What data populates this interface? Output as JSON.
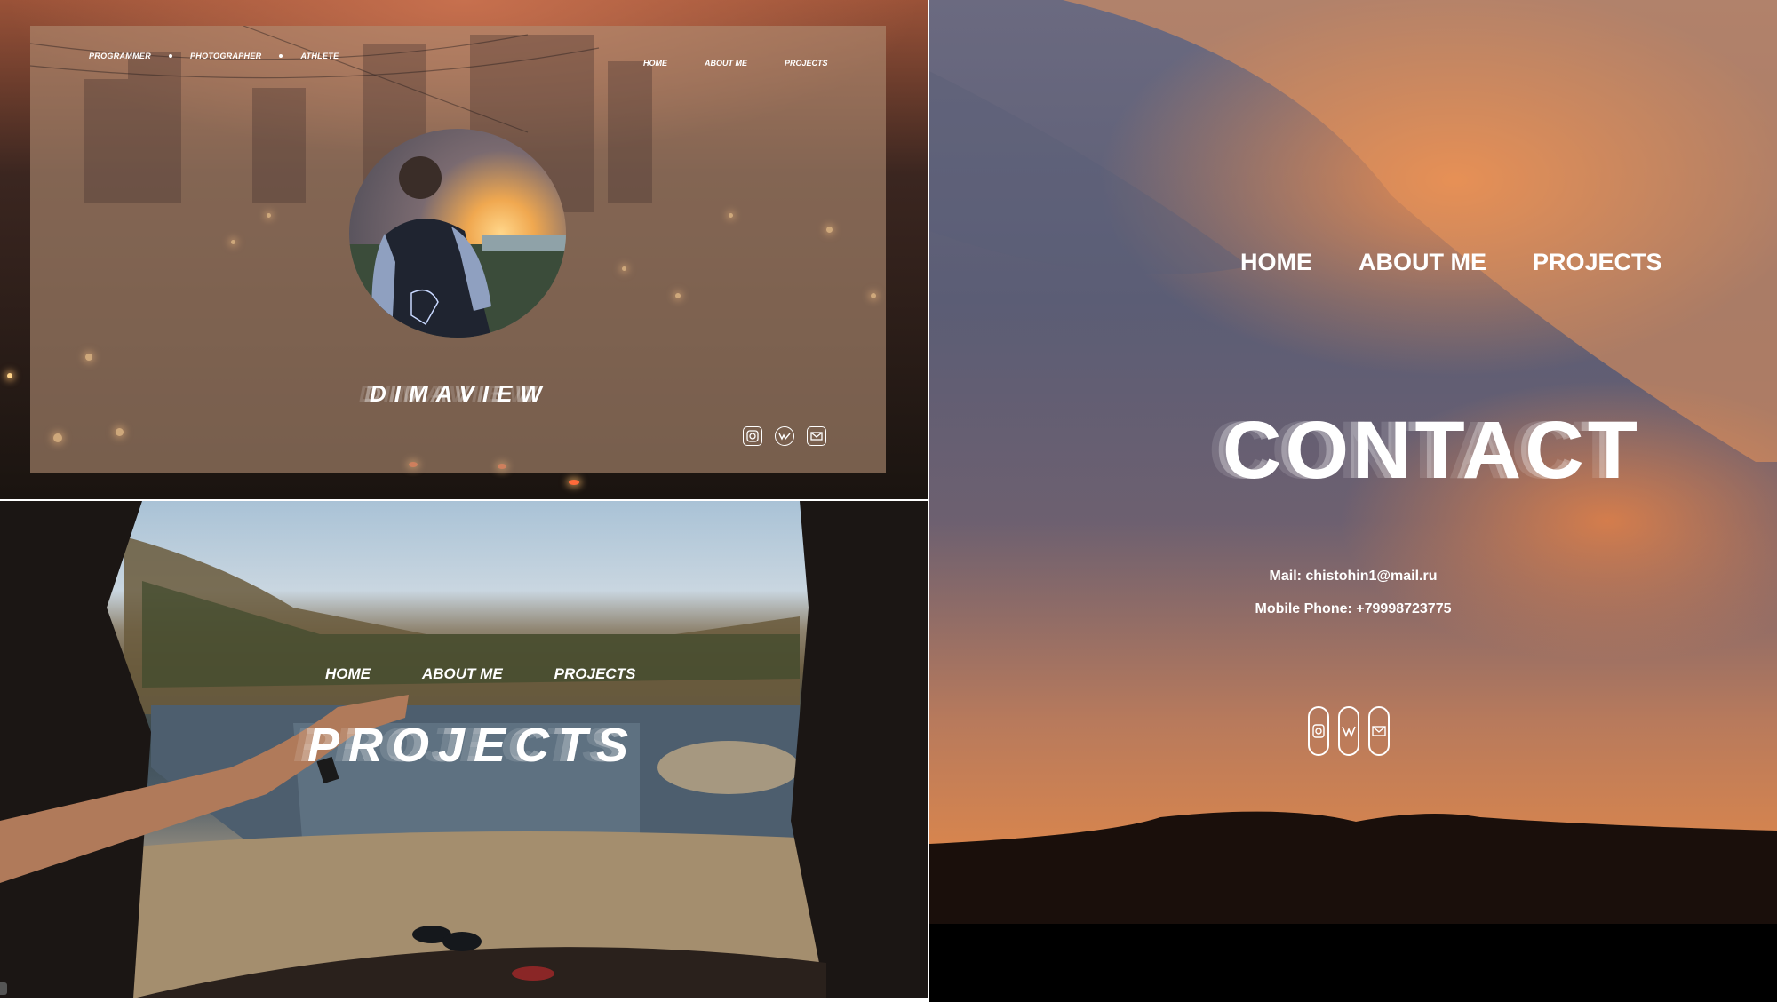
{
  "home": {
    "tagline": [
      "PROGRAMMER",
      "PHOTOGRAPHER",
      "ATHLETE"
    ],
    "nav": [
      "HOME",
      "ABOUT ME",
      "PROJECTS"
    ],
    "brand": "DIMAVIEW",
    "social_icons": [
      "instagram-icon",
      "vk-icon",
      "mail-icon"
    ]
  },
  "projects": {
    "nav": [
      "HOME",
      "ABOUT ME",
      "PROJECTS"
    ],
    "title": "PROJECTS"
  },
  "contact": {
    "nav": [
      "HOME",
      "ABOUT ME",
      "PROJECTS"
    ],
    "title": "CONTACT",
    "mail": "Mail: chistohin1@mail.ru",
    "phone": "Mobile Phone: +79998723775",
    "social_icons": [
      "instagram-icon",
      "vk-icon",
      "mail-icon"
    ]
  },
  "colors": {
    "text": "#ffffff",
    "card_overlay": "#b08c73",
    "sunset_orange": "#e0884a"
  }
}
